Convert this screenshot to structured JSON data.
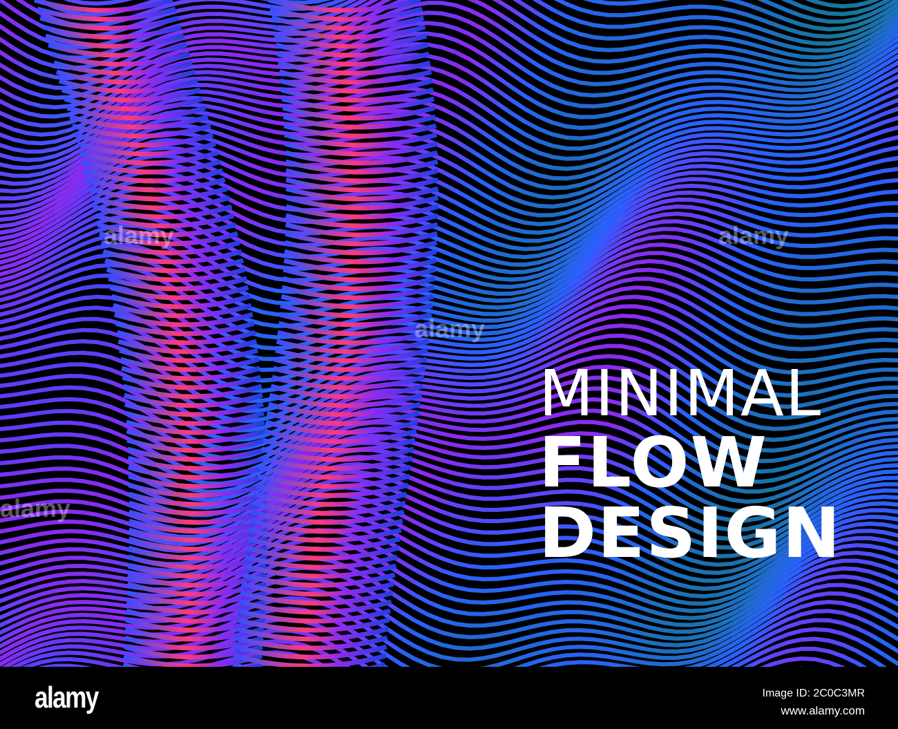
{
  "artwork": {
    "title_line1": "MINIMAL",
    "title_line2": "FLOW",
    "title_line3": "DESIGN",
    "colors": {
      "pink": "#ff3a7a",
      "purple": "#8a2bf0",
      "blue": "#3050ff",
      "cyan": "#1aa0e0",
      "teal": "#147890",
      "background": "#000000"
    }
  },
  "watermark": {
    "text": "alamy"
  },
  "footer": {
    "logo": "alamy",
    "image_id": "Image ID: 2C0C3MR",
    "url": "www.alamy.com"
  }
}
